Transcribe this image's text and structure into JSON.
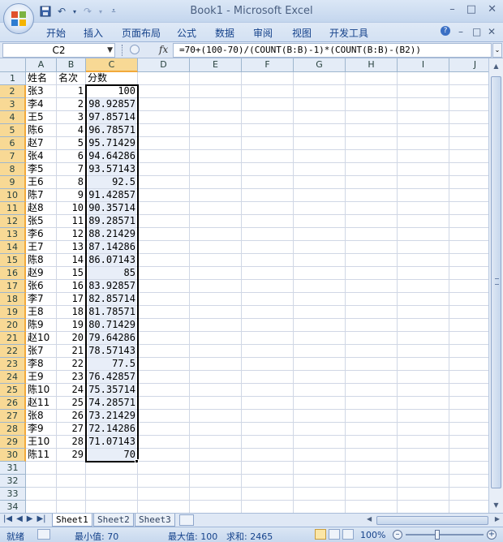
{
  "window": {
    "title": "Book1 - Microsoft Excel",
    "controls": [
      "–",
      "□",
      "✕"
    ]
  },
  "ribbon": {
    "tabs": [
      "开始",
      "插入",
      "页面布局",
      "公式",
      "数据",
      "审阅",
      "视图",
      "开发工具"
    ],
    "right_controls": [
      "?",
      "–",
      "□",
      "✕"
    ]
  },
  "formula_bar": {
    "name_box": "C2",
    "fx": "fx",
    "formula": "=70+(100-70)/(COUNT(B:B)-1)*(COUNT(B:B)-(B2))"
  },
  "grid": {
    "columns": [
      "A",
      "B",
      "C",
      "D",
      "E",
      "F",
      "G",
      "H",
      "I",
      "J"
    ],
    "selected_column": "C",
    "selected_rows_from": 2,
    "selected_rows_to": 30,
    "rows": [
      [
        "姓名",
        "名次",
        "分数"
      ],
      [
        "张3",
        "1",
        "100"
      ],
      [
        "李4",
        "2",
        "98.92857"
      ],
      [
        "王5",
        "3",
        "97.85714"
      ],
      [
        "陈6",
        "4",
        "96.78571"
      ],
      [
        "赵7",
        "5",
        "95.71429"
      ],
      [
        "张4",
        "6",
        "94.64286"
      ],
      [
        "李5",
        "7",
        "93.57143"
      ],
      [
        "王6",
        "8",
        "92.5"
      ],
      [
        "陈7",
        "9",
        "91.42857"
      ],
      [
        "赵8",
        "10",
        "90.35714"
      ],
      [
        "张5",
        "11",
        "89.28571"
      ],
      [
        "李6",
        "12",
        "88.21429"
      ],
      [
        "王7",
        "13",
        "87.14286"
      ],
      [
        "陈8",
        "14",
        "86.07143"
      ],
      [
        "赵9",
        "15",
        "85"
      ],
      [
        "张6",
        "16",
        "83.92857"
      ],
      [
        "李7",
        "17",
        "82.85714"
      ],
      [
        "王8",
        "18",
        "81.78571"
      ],
      [
        "陈9",
        "19",
        "80.71429"
      ],
      [
        "赵10",
        "20",
        "79.64286"
      ],
      [
        "张7",
        "21",
        "78.57143"
      ],
      [
        "李8",
        "22",
        "77.5"
      ],
      [
        "王9",
        "23",
        "76.42857"
      ],
      [
        "陈10",
        "24",
        "75.35714"
      ],
      [
        "赵11",
        "25",
        "74.28571"
      ],
      [
        "张8",
        "26",
        "73.21429"
      ],
      [
        "李9",
        "27",
        "72.14286"
      ],
      [
        "王10",
        "28",
        "71.07143"
      ],
      [
        "陈11",
        "29",
        "70"
      ],
      [
        "",
        "",
        ""
      ],
      [
        "",
        "",
        ""
      ],
      [
        "",
        "",
        ""
      ],
      [
        "",
        "",
        ""
      ]
    ]
  },
  "sheets": {
    "tabs": [
      "Sheet1",
      "Sheet2",
      "Sheet3"
    ],
    "active": "Sheet1"
  },
  "status": {
    "mode": "就绪",
    "min": "最小值: 70",
    "max": "最大值: 100",
    "sum": "求和: 2465",
    "zoom": "100%"
  }
}
